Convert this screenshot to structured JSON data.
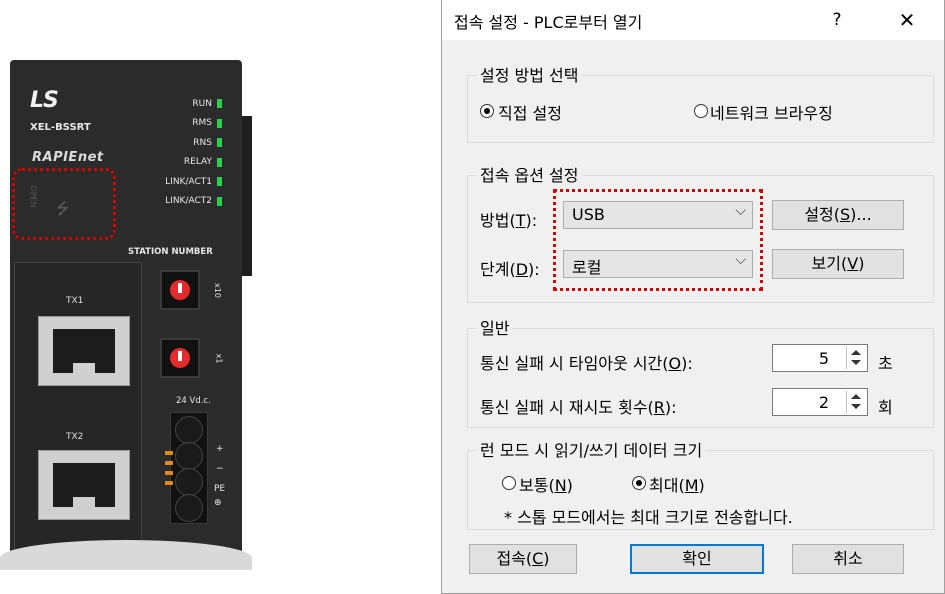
{
  "device": {
    "logo": "LS",
    "model": "XEL-BSSRT",
    "brand": "RAPIEnet",
    "leds": [
      "RUN",
      "RMS",
      "RNS",
      "RELAY",
      "LINK/ACT1",
      "LINK/ACT2"
    ],
    "usb_label": "OPEN",
    "usb_symbol": "⭍",
    "station_number": "STATION NUMBER",
    "port1": "TX1",
    "port2": "TX2",
    "dial1_label": "x10",
    "dial2_label": "x1",
    "power_label": "24 Vd.c.",
    "terminal_plus": "+",
    "terminal_minus": "−",
    "terminal_pe": "PE",
    "terminal_ground": "⊕",
    "led_color": "#28d14a",
    "highlight_color": "#d10000"
  },
  "dialog": {
    "title": "접속 설정 - PLC로부터 열기",
    "help": "?",
    "close": "✕",
    "method_group": {
      "label": "설정 방법 선택",
      "direct": "직접 설정",
      "network": "네트워크 브라우징",
      "selected": "direct"
    },
    "options_group": {
      "label": "접속 옵션 설정",
      "method_label_pre": "방법(",
      "method_key": "T",
      "method_label_post": "):",
      "method_value": "USB",
      "settings_btn_pre": "설정(",
      "settings_btn_key": "S",
      "settings_btn_post": ")...",
      "level_label_pre": "단계(",
      "level_key": "D",
      "level_label_post": "):",
      "level_value": "로컬",
      "view_btn_pre": "보기(",
      "view_btn_key": "V",
      "view_btn_post": ")"
    },
    "general_group": {
      "label": "일반",
      "timeout_label_pre": "통신 실패 시 타임아웃 시간(",
      "timeout_key": "O",
      "timeout_label_post": "):",
      "timeout_value": "5",
      "timeout_unit": "초",
      "retry_label_pre": "통신 실패 시 재시도 횟수(",
      "retry_key": "R",
      "retry_label_post": "):",
      "retry_value": "2",
      "retry_unit": "회"
    },
    "size_group": {
      "label": "런 모드 시 읽기/쓰기 데이터 크기",
      "normal_pre": "보통(",
      "normal_key": "N",
      "normal_post": ")",
      "max_pre": "최대(",
      "max_key": "M",
      "max_post": ")",
      "selected": "max",
      "note": "* 스톱 모드에서는 최대 크기로 전송합니다."
    },
    "buttons": {
      "connect_pre": "접속(",
      "connect_key": "C",
      "connect_post": ")",
      "ok": "확인",
      "cancel": "취소"
    },
    "accent_color": "#0078d7"
  }
}
